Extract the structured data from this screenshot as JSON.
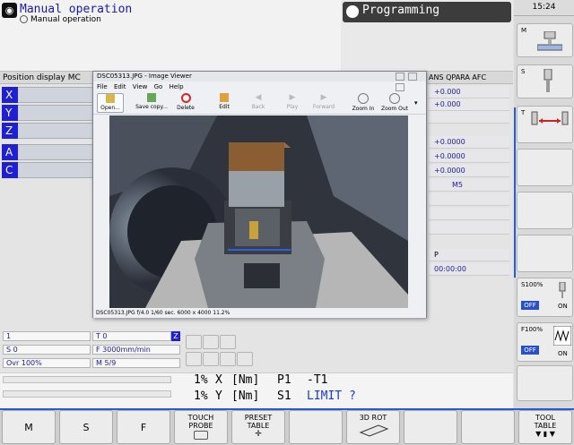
{
  "header": {
    "mode_title": "Manual operation",
    "mode_subtitle": "Manual operation",
    "programming_label": "Programming",
    "clock": "15:24"
  },
  "position_display": {
    "label": "Position display MC",
    "right_label": "ANS QPARA AFC",
    "axes": [
      "X",
      "Y",
      "Z",
      "A",
      "C"
    ],
    "values": [
      "+0.000",
      "+0.000",
      "",
      "+0.0000",
      "+0.0000",
      "+0.0000",
      "M5",
      "",
      "",
      "",
      "P",
      "00:00:00"
    ]
  },
  "status": {
    "tool": "1",
    "t_value": "T 0",
    "s_value": "S 0",
    "feed": "F 3000mm/min",
    "ovr": "Ovr 100%",
    "m_value": "M 5/9",
    "z_tag": "Z"
  },
  "status_line": {
    "row1": [
      "1%",
      "X",
      "[Nm]",
      "P1",
      "-T1"
    ],
    "row2": [
      "1%",
      "Y",
      "[Nm]",
      "S1",
      "LIMIT ?"
    ]
  },
  "right_softkeys": {
    "m": "M",
    "s": "S",
    "t": "T",
    "s100": "S100%",
    "f100": "F100%",
    "off": "OFF",
    "on": "ON"
  },
  "bottom_softkeys": [
    {
      "line1": "M",
      "line2": ""
    },
    {
      "line1": "S",
      "line2": ""
    },
    {
      "line1": "F",
      "line2": ""
    },
    {
      "line1": "TOUCH",
      "line2": "PROBE"
    },
    {
      "line1": "PRESET",
      "line2": "TABLE"
    },
    {
      "line1": "",
      "line2": ""
    },
    {
      "line1": "3D ROT",
      "line2": ""
    },
    {
      "line1": "",
      "line2": ""
    },
    {
      "line1": "",
      "line2": ""
    },
    {
      "line1": "TOOL",
      "line2": "TABLE"
    }
  ],
  "image_viewer": {
    "title": "DSC05313.JPG - Image Viewer",
    "menu": [
      "File",
      "Edit",
      "View",
      "Go",
      "Help"
    ],
    "toolbar": [
      "Open...",
      "Save copy...",
      "Delete",
      "Edit",
      "Back",
      "Play",
      "Forward",
      "Zoom In",
      "Zoom Out"
    ],
    "status": "DSC05313.JPG  f/4.0 1/60 sec.  6000 x 4000    11.2%"
  }
}
